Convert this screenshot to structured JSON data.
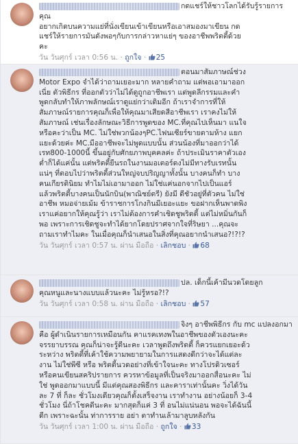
{
  "comments": [
    {
      "text": "กดแชร์ให้ชาวโลกได้รับรู้รายการคุณ\nอยากเกิดบนความแย่ที่นั่งเขียนเข้าเขียนหรือเอาสมองมาเขียน กด\nแชร์ให้รายการมันดังพอๆกับการกล่าวหาแย่ๆ ของอาชีพพริตตี้ด้วย\nคะ",
      "time": "วัน วันศุกร์ เวลา 0:56 น.",
      "like_label": "ถูกใจ",
      "likes": "25"
    },
    {
      "text": "ตอนมาสัมภาษณ์ช่วง\nMotor Expo จำได้ว่าถามเยอะมาก หลายคำถาม แต่พอเอามาออก\nเนี่ย ตัวพิธีกร ที่ออกตัวว่าไม่ได้ดูถูกอาชีพเรา แต่พูดลีกรรมและคำ\nพูดกลับทำให้ภาพลักษณ์เราดูแย่กว่าเดิมอีก ถ้าเราจำการที่ให้\nสัมภาษณ์รายการคุณก็เพื่อให้คุณมาเสียดสีอาชีพเรา เราคงไม่ให้\nสัมภาษณ์ เช่นเรื่องลักษณะวิธีการพูดของ MC.ที่คุณไปเห็นมา แนใจ\nหรือคะว่าเป็น MC. ไม่ใช่พวกน้องๆPC.ไฟนเซียร์ขายตามห้าง แยก\nแยะด้วยค่ะ MC.มืออาชีพจะไม่พูดแบบนั้น ส่วนน้องที่มาออกว่าได้\nเรท800-1000นี้ ขึ้นอยู่กับศักยภาพบุคคลค่ะ ถ้าประเมินราคาตัวเอง\nต่ำก็ได้แค่นั้น แต่พริตตี้ยืนรถในงานมอเตอร์ดงไม่มีทางรับเรทนั้น\nแน่ๆ ที่ตอบไปว่าพริตตี้ส่วนใหญ่จบปริญญาทั้งนั้น บางคนก็ทำ บาง\nคนเกียรตินิยม ทำไมไม่เอามาออก ไม่ใช่แค่นอกจากไปเป็นแอร์\nแล้วพริตตี้บางคนเป็นนักบิน(พาณิชย์ตรี) ยังมี ดีชัวอยู่ที่ตัวคน ไม่ใช่\nอาชีพ หมอจ่ายเม้ม ข้าราชการโกงกินมีเยอะแยะ ขอฝากเห็นพาดพิง\nเราแค่อยากให้คุณรู้ว่า เราไม่ต้องการคำเชิดชูพริตตี้ แต่ไม่หมิ่นกันก็\nพอ เพราะการเชิดชูจะทำได้ยากโดยปราศจากใจที่ริษยา ...คุณจะ\nถามเราทำไมคะ ในเมื่อคุณก็นำเสนอในสิ่งที่คุณอยากนำเสนอ?!?!?",
      "time": "วัน วันศุกร์ เวลา 0:57 น.",
      "via": "ผ่าน มือถือ",
      "like_label": "เลิกชอบ",
      "likes": "68"
    },
    {
      "text": "ปล. เด็กนี้เค้ามีนวดโดยลูก\nคุณหนูและนางแบบแล้วนะคะ ไม่รู้หรอ?!?",
      "time": "วัน วันศุกร์ เวลา 0:58 น.",
      "via": "ผ่าน มือถือ",
      "like_label": "เลิกชอบ",
      "likes": "57"
    },
    {
      "text": "จิงๆ อาชีพพิธีกร กับ mc แปลงอกมา\nคือ ผู้ดำเนินรายการเหมือนกัน คาแรคเทงพในอาชีพของตัวเองนะคะ\nจรรยาบรรณ คุณก็น่าจะรู้ดีนะคะ เวลาพูดถึงพริตตี้ ก็ควรแยกเยอะด้ว\nระหว่าง พริตตี้ที่เค้าใช้ความพยายามในการแสดงดีกว่าจะได้แต่ละ\nงาน ไม่ใช่พีซี หรือ พริตตี้นวดอย่างที่เข้าใจนะคะ ทางโปรดิวเซอร์\nหรือคนเขียนสคริปรายการ ควรหาข้อมูลที่เป็นจริงมาออกสื่อนะคะ ไม่\nใช่ พูดออกมาแบบนี้ มีแต่คุณสองพิธีกร และคาราเท่านั้นคะ วิ่งได้วัน\nละ 7 ที่ ก็ละ ชั่วโมงเดียวคุณก็ตั้งเสร็จงาน เราทำงาน อย่างน้อยก็ 3-4\nชั่วโมง นี่ถ้าโชคดีนะคะ มากสุดก็แค่ 3 ที่ อนไม่แน่นอน พอจะได้ฉันนี้\nดีก เพราะฉะนั้น ท่าการราย อย่า ตาทำนเล้ามาลูบหลังกัน",
      "time": "วัน วันศุกร์ เวลา 1:00 น.",
      "via": "ผ่าน มือถือ",
      "like_label": "ถูกใจ",
      "likes": "33"
    }
  ],
  "icons": {
    "like": "thumbs-up-icon"
  },
  "colors": {
    "link": "#3b5998",
    "meta": "#999999",
    "text": "#333333",
    "comment_bg": "#edeff4"
  }
}
